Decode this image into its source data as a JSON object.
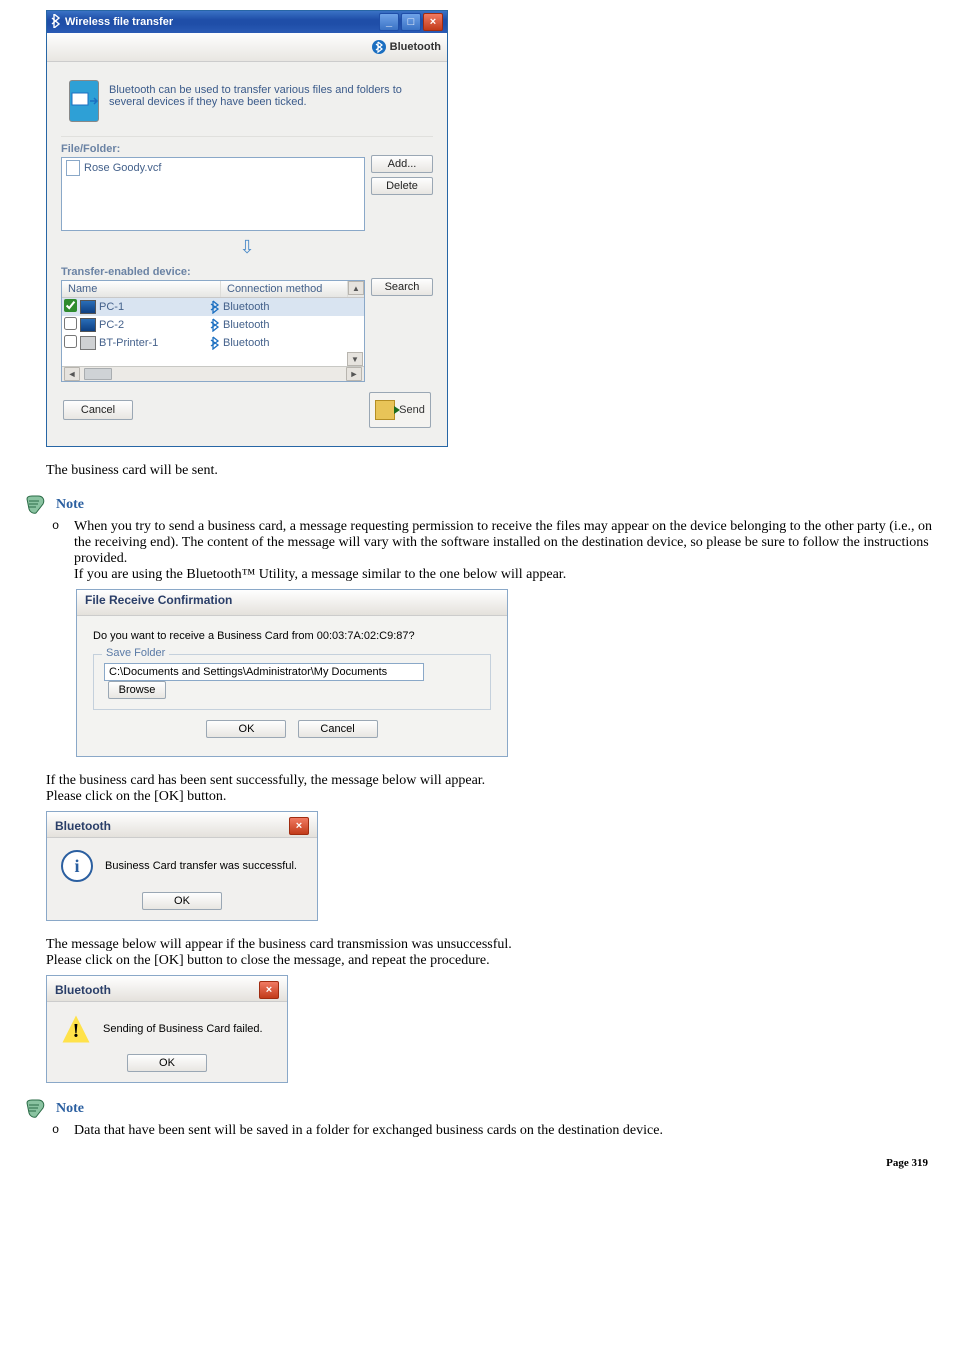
{
  "wft": {
    "title": "Wireless file transfer",
    "brand": "Bluetooth",
    "intro": "Bluetooth can be used to transfer various files and folders to several devices if they have been ticked.",
    "file_folder_label": "File/Folder:",
    "files": [
      "Rose Goody.vcf"
    ],
    "buttons": {
      "add": "Add...",
      "delete": "Delete",
      "search": "Search",
      "cancel": "Cancel",
      "send": "Send"
    },
    "device_section_label": "Transfer-enabled device:",
    "device_columns": {
      "name": "Name",
      "conn": "Connection method"
    },
    "devices": [
      {
        "checked": true,
        "name": "PC-1",
        "conn": "Bluetooth",
        "type": "pc",
        "highlight": true
      },
      {
        "checked": false,
        "name": "PC-2",
        "conn": "Bluetooth",
        "type": "pc",
        "highlight": false
      },
      {
        "checked": false,
        "name": "BT-Printer-1",
        "conn": "Bluetooth",
        "type": "printer",
        "highlight": false
      }
    ]
  },
  "body1": "The business card will be sent.",
  "note1_heading": "Note",
  "note1_text_a": "When you try to send a business card, a message requesting permission to receive the files may appear on the device belonging to the other party (i.e., on the receiving end). The content of the message will vary with the software installed on the destination device, so please be sure to follow the instructions provided.",
  "note1_text_b": "If you are using the Bluetooth™ Utility, a message similar to the one below will appear.",
  "frc": {
    "title": "File Receive Confirmation",
    "question": "Do you want to receive a Business Card from 00:03:7A:02:C9:87?",
    "legend": "Save Folder",
    "path": "C:\\Documents and Settings\\Administrator\\My Documents",
    "browse": "Browse",
    "ok": "OK",
    "cancel": "Cancel"
  },
  "body2a": "If the business card has been sent successfully, the message below will appear.",
  "body2b": "Please click on the [OK] button.",
  "msg_success": {
    "title": "Bluetooth",
    "text": "Business Card transfer was successful.",
    "ok": "OK"
  },
  "body3a": "The message below will appear if the business card transmission was unsuccessful.",
  "body3b": "Please click on the [OK] button to close the message, and repeat the procedure.",
  "msg_fail": {
    "title": "Bluetooth",
    "text": "Sending of Business Card failed.",
    "ok": "OK"
  },
  "note2_heading": "Note",
  "note2_text": "Data that have been sent will be saved in a folder for exchanged business cards on the destination device.",
  "page_footer": "Page 319"
}
